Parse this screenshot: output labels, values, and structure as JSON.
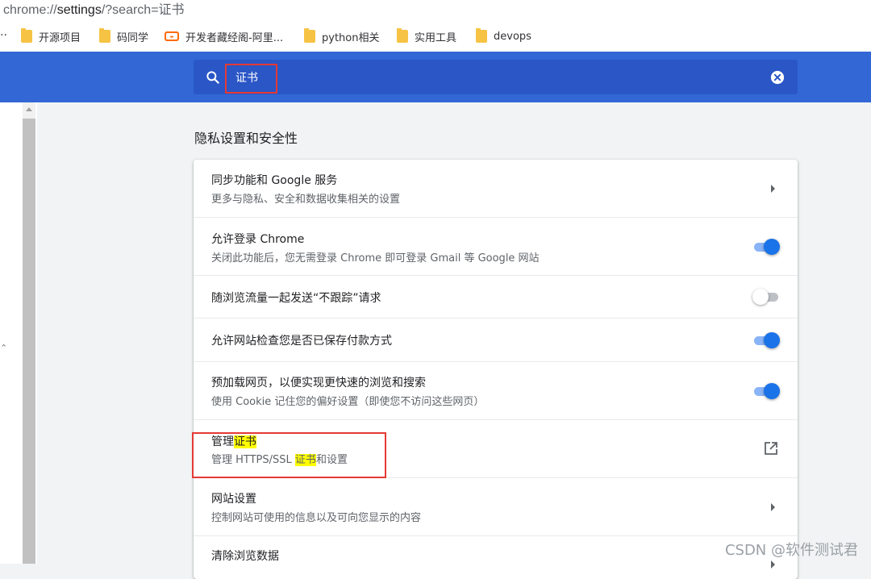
{
  "browser": {
    "url_scheme": "chrome://",
    "url_host": "settings",
    "url_path": "/?search=证书"
  },
  "bookmarks": {
    "overflow": "..",
    "items": [
      {
        "label": "开源项目",
        "icon": "folder-icon"
      },
      {
        "label": "码同学",
        "icon": "folder-icon"
      },
      {
        "label": "开发者藏经阁-阿里...",
        "icon": "aliyun-icon"
      },
      {
        "label": "python相关",
        "icon": "folder-icon"
      },
      {
        "label": "实用工具",
        "icon": "folder-icon"
      },
      {
        "label": "devops",
        "icon": "folder-icon"
      }
    ]
  },
  "search": {
    "value": "证书",
    "accent_color": "#3367d6"
  },
  "section": {
    "title": "隐私设置和安全性"
  },
  "rows": [
    {
      "title": "同步功能和 Google 服务",
      "subtitle": "更多与隐私、安全和数据收集相关的设置",
      "control": "arrow"
    },
    {
      "title": "允许登录 Chrome",
      "subtitle": "关闭此功能后，您无需登录 Chrome 即可登录 Gmail 等 Google 网站",
      "control": "toggle-on"
    },
    {
      "title": "随浏览流量一起发送“不跟踪”请求",
      "subtitle": "",
      "control": "toggle-off"
    },
    {
      "title": "允许网站检查您是否已保存付款方式",
      "subtitle": "",
      "control": "toggle-on"
    },
    {
      "title": "预加载网页，以便实现更快速的浏览和搜索",
      "subtitle": "使用 Cookie 记住您的偏好设置（即使您不访问这些网页）",
      "control": "toggle-on"
    },
    {
      "title_prefix": "管理",
      "title_highlight": "证书",
      "subtitle_prefix": "管理 HTTPS/SSL ",
      "subtitle_highlight": "证书",
      "subtitle_suffix": "和设置",
      "control": "external-link"
    },
    {
      "title": "网站设置",
      "subtitle": "控制网站可使用的信息以及可向您显示的内容",
      "control": "arrow"
    },
    {
      "title": "清除浏览数据",
      "subtitle": "",
      "control": "arrow"
    }
  ],
  "watermark": "CSDN @软件测试君"
}
